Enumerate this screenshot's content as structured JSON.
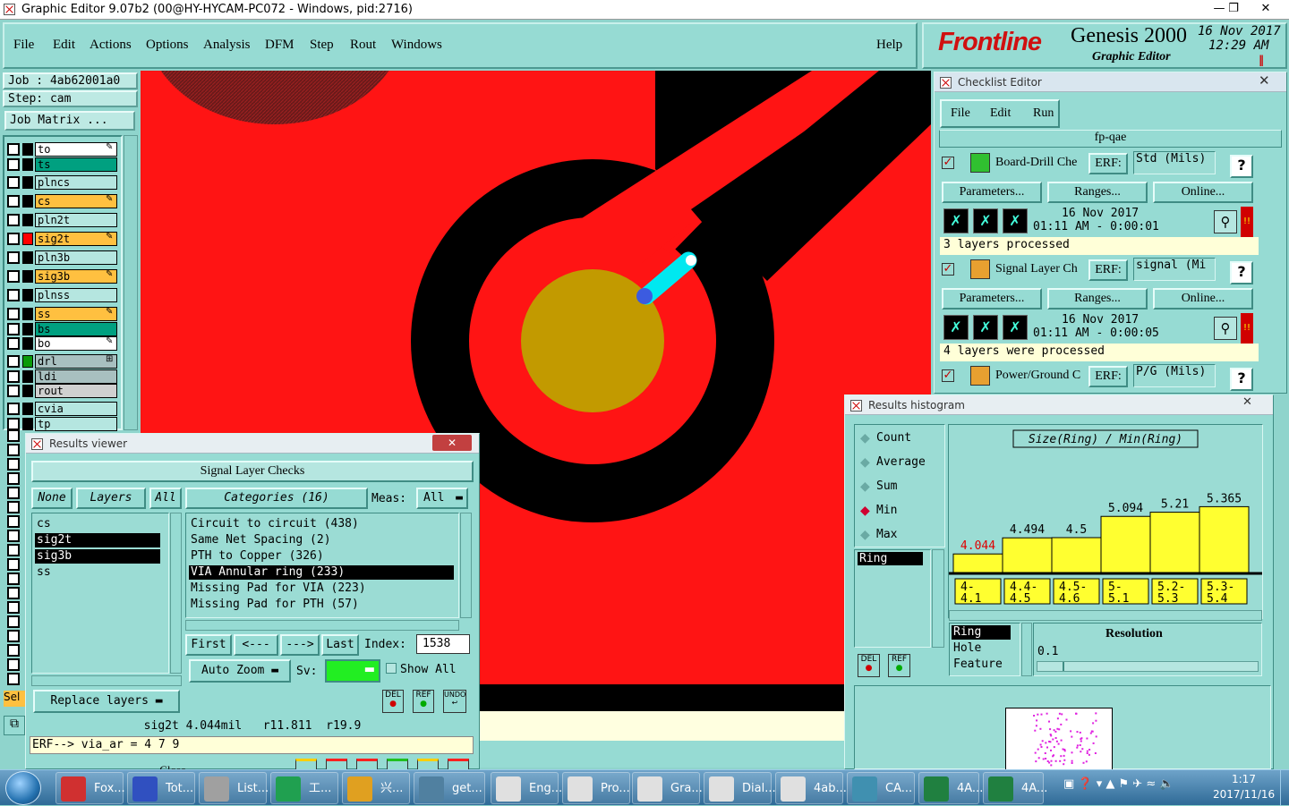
{
  "window": {
    "title": "Graphic Editor 9.07b2 (00@HY-HYCAM-PC072 - Windows, pid:2716)"
  },
  "menu": [
    "File",
    "Edit",
    "Actions",
    "Options",
    "Analysis",
    "DFM",
    "Step",
    "Rout",
    "Windows"
  ],
  "help_label": "Help",
  "brand": {
    "logo": "Frontline",
    "product": "Genesis 2000",
    "subtitle": "Graphic Editor",
    "date": "16 Nov 2017",
    "time": "12:29 AM"
  },
  "job": {
    "job_label": "Job : 4ab62001a0",
    "step_label": "Step: cam",
    "matrix_button": "Job Matrix ..."
  },
  "layers": [
    {
      "name": "to",
      "color": "#ffffff",
      "icon": "✎"
    },
    {
      "name": "ts",
      "color": "#00a080",
      "icon": ""
    },
    {
      "name": "plncs",
      "color": "#b5e6e0",
      "icon": ""
    },
    {
      "name": "cs",
      "color": "#ffc040",
      "icon": "✎"
    },
    {
      "name": "pln2t",
      "color": "#b5e6e0",
      "icon": ""
    },
    {
      "name": "sig2t",
      "color": "#ffc040",
      "icon": "✎"
    },
    {
      "name": "pln3b",
      "color": "#b5e6e0",
      "icon": ""
    },
    {
      "name": "sig3b",
      "color": "#ffc040",
      "icon": "✎"
    },
    {
      "name": "plnss",
      "color": "#b5e6e0",
      "icon": ""
    },
    {
      "name": "ss",
      "color": "#ffc040",
      "icon": "✎"
    },
    {
      "name": "bs",
      "color": "#00a080",
      "icon": ""
    },
    {
      "name": "bo",
      "color": "#ffffff",
      "icon": "✎"
    },
    {
      "name": "drl",
      "color": "#a8c0c0",
      "icon": "⊞"
    },
    {
      "name": "ldi",
      "color": "#a8c0c0",
      "icon": ""
    },
    {
      "name": "rout",
      "color": "#d0d0d0",
      "icon": ""
    },
    {
      "name": "cvia",
      "color": "#b5e6e0",
      "icon": ""
    },
    {
      "name": "tp",
      "color": "#b5e6e0",
      "icon": ""
    }
  ],
  "checklist": {
    "title": "Checklist Editor",
    "menu": [
      "File",
      "Edit",
      "Run"
    ],
    "name": "fp-qae",
    "items": [
      {
        "name": "Board-Drill Che",
        "erf_label": "ERF:",
        "erf": "Std (Mils)",
        "params": "Parameters...",
        "ranges": "Ranges...",
        "online": "Online...",
        "date": "16 Nov 2017",
        "time": "01:11 AM - 0:00:01",
        "status": "3 layers processed"
      },
      {
        "name": "Signal Layer Ch",
        "erf_label": "ERF:",
        "erf": "signal (Mi",
        "params": "Parameters...",
        "ranges": "Ranges...",
        "online": "Online...",
        "date": "16 Nov 2017",
        "time": "01:11 AM - 0:00:05",
        "status": "4 layers were processed"
      },
      {
        "name": "Power/Ground C",
        "erf_label": "ERF:",
        "erf": "P/G (Mils)"
      }
    ],
    "help": "?"
  },
  "results_viewer": {
    "title": "Results viewer",
    "header": "Signal Layer Checks",
    "none_btn": "None",
    "layers_btn": "Layers",
    "all_btn": "All",
    "categories_btn": "Categories (16)",
    "meas_label": "Meas:",
    "meas_value": "All",
    "layers": [
      "cs",
      "sig2t",
      "sig3b",
      "ss"
    ],
    "categories": [
      "Circuit to circuit (438)",
      "Same Net Spacing (2)",
      "PTH to Copper (326)",
      "VIA Annular ring (233)",
      "Missing Pad for VIA (223)",
      "Missing Pad for PTH (57)"
    ],
    "nav": {
      "first": "First",
      "prev": "<---",
      "next": "--->",
      "last": "Last",
      "index_label": "Index:",
      "index_value": "1538"
    },
    "auto_zoom": "Auto Zoom",
    "sv_label": "Sv:",
    "show_all": "Show All",
    "replace_layers": "Replace layers",
    "del": "DEL",
    "ref": "REF",
    "undo": "UNDO",
    "status": "sig2t 4.044mil   r11.811  r19.9",
    "erf_line": "ERF--> via_ar = 4 7 9",
    "close": "Close"
  },
  "histogram": {
    "title": "Results histogram",
    "options": [
      "Count",
      "Average",
      "Sum",
      "Min",
      "Max"
    ],
    "selected_option": "Min",
    "list": [
      "Ring"
    ],
    "modes": [
      "Ring",
      "Hole",
      "Feature"
    ],
    "resolution_label": "Resolution",
    "resolution_value": "0.1",
    "del": "DEL",
    "ref": "REF"
  },
  "chart_data": {
    "type": "bar",
    "title": "Size(Ring) / Min(Ring)",
    "categories": [
      "4-\n4.1",
      "4.4-\n4.5",
      "4.5-\n4.6",
      "5-\n5.1",
      "5.2-\n5.3",
      "5.3-\n5.4"
    ],
    "values": [
      4.044,
      4.494,
      4.5,
      5.094,
      5.21,
      5.365
    ],
    "labels": [
      "4.044",
      "4.494",
      "4.5",
      "5.094",
      "5.21",
      "5.365"
    ],
    "highlight_color": "#e00000",
    "bar_color": "#ffff30"
  },
  "taskbar": {
    "items": [
      "Fox...",
      "Tot...",
      "List...",
      "工...",
      "兴...",
      "get...",
      "Eng...",
      "Pro...",
      "Gra...",
      "Dial...",
      "4ab...",
      "CA...",
      "4A...",
      "4A..."
    ],
    "clock_time": "1:17",
    "clock_date": "2017/11/16"
  }
}
